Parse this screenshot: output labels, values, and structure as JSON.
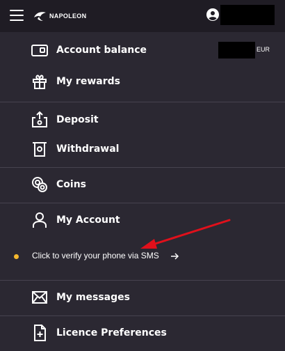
{
  "header": {
    "logo_text": "NAPOLEON"
  },
  "menu": {
    "account_balance": "Account balance",
    "balance_currency": "EUR",
    "my_rewards": "My rewards",
    "deposit": "Deposit",
    "withdrawal": "Withdrawal",
    "coins": "Coins",
    "my_account": "My Account",
    "verify_phone": "Click to verify your phone via SMS",
    "my_messages": "My messages",
    "licence_preferences": "Licence Preferences"
  },
  "colors": {
    "background": "#2b2832",
    "topbar": "#1f1c24",
    "notice_dot": "#f5b82e",
    "annotation_arrow": "#e0101b"
  }
}
